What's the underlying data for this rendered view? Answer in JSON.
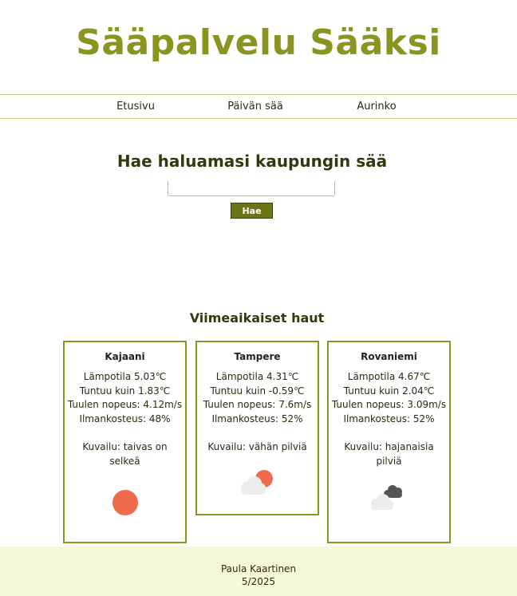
{
  "header": {
    "title": "Sääpalvelu Sääksi"
  },
  "nav": {
    "items": [
      "Etusivu",
      "Päivän sää",
      "Aurinko"
    ]
  },
  "search": {
    "title": "Hae haluamasi kaupungin sää",
    "input_value": "",
    "button_label": "Hae"
  },
  "recent": {
    "title": "Viimeaikaiset haut",
    "cards": [
      {
        "city": "Kajaani",
        "temperature": "Lämpotila 5.03℃",
        "feels_like": "Tuntuu kuin 1.83℃",
        "wind": "Tuulen nopeus: 4.12m/s",
        "humidity": "Ilmankosteus: 48%",
        "description": "Kuvailu: taivas on selkeä",
        "icon": "sun-icon"
      },
      {
        "city": "Tampere",
        "temperature": "Lämpotila 4.31℃",
        "feels_like": "Tuntuu kuin -0.59℃",
        "wind": "Tuulen nopeus: 7.6m/s",
        "humidity": "Ilmankosteus: 52%",
        "description": "Kuvailu: vähän pilviä",
        "icon": "sun-behind-cloud-icon"
      },
      {
        "city": "Rovaniemi",
        "temperature": "Lämpotila 4.67℃",
        "feels_like": "Tuntuu kuin 2.04℃",
        "wind": "Tuulen nopeus: 3.09m/s",
        "humidity": "Ilmankosteus: 52%",
        "description": "Kuvailu: hajanaisia pilviä",
        "icon": "scattered-clouds-icon"
      }
    ]
  },
  "footer": {
    "author": "Paula Kaartinen",
    "date": "5/2025"
  },
  "colors": {
    "accent": "#8a9420",
    "button": "#6b7516",
    "footer_bg": "#f6f8dc",
    "sun": "#ee6b4d"
  }
}
